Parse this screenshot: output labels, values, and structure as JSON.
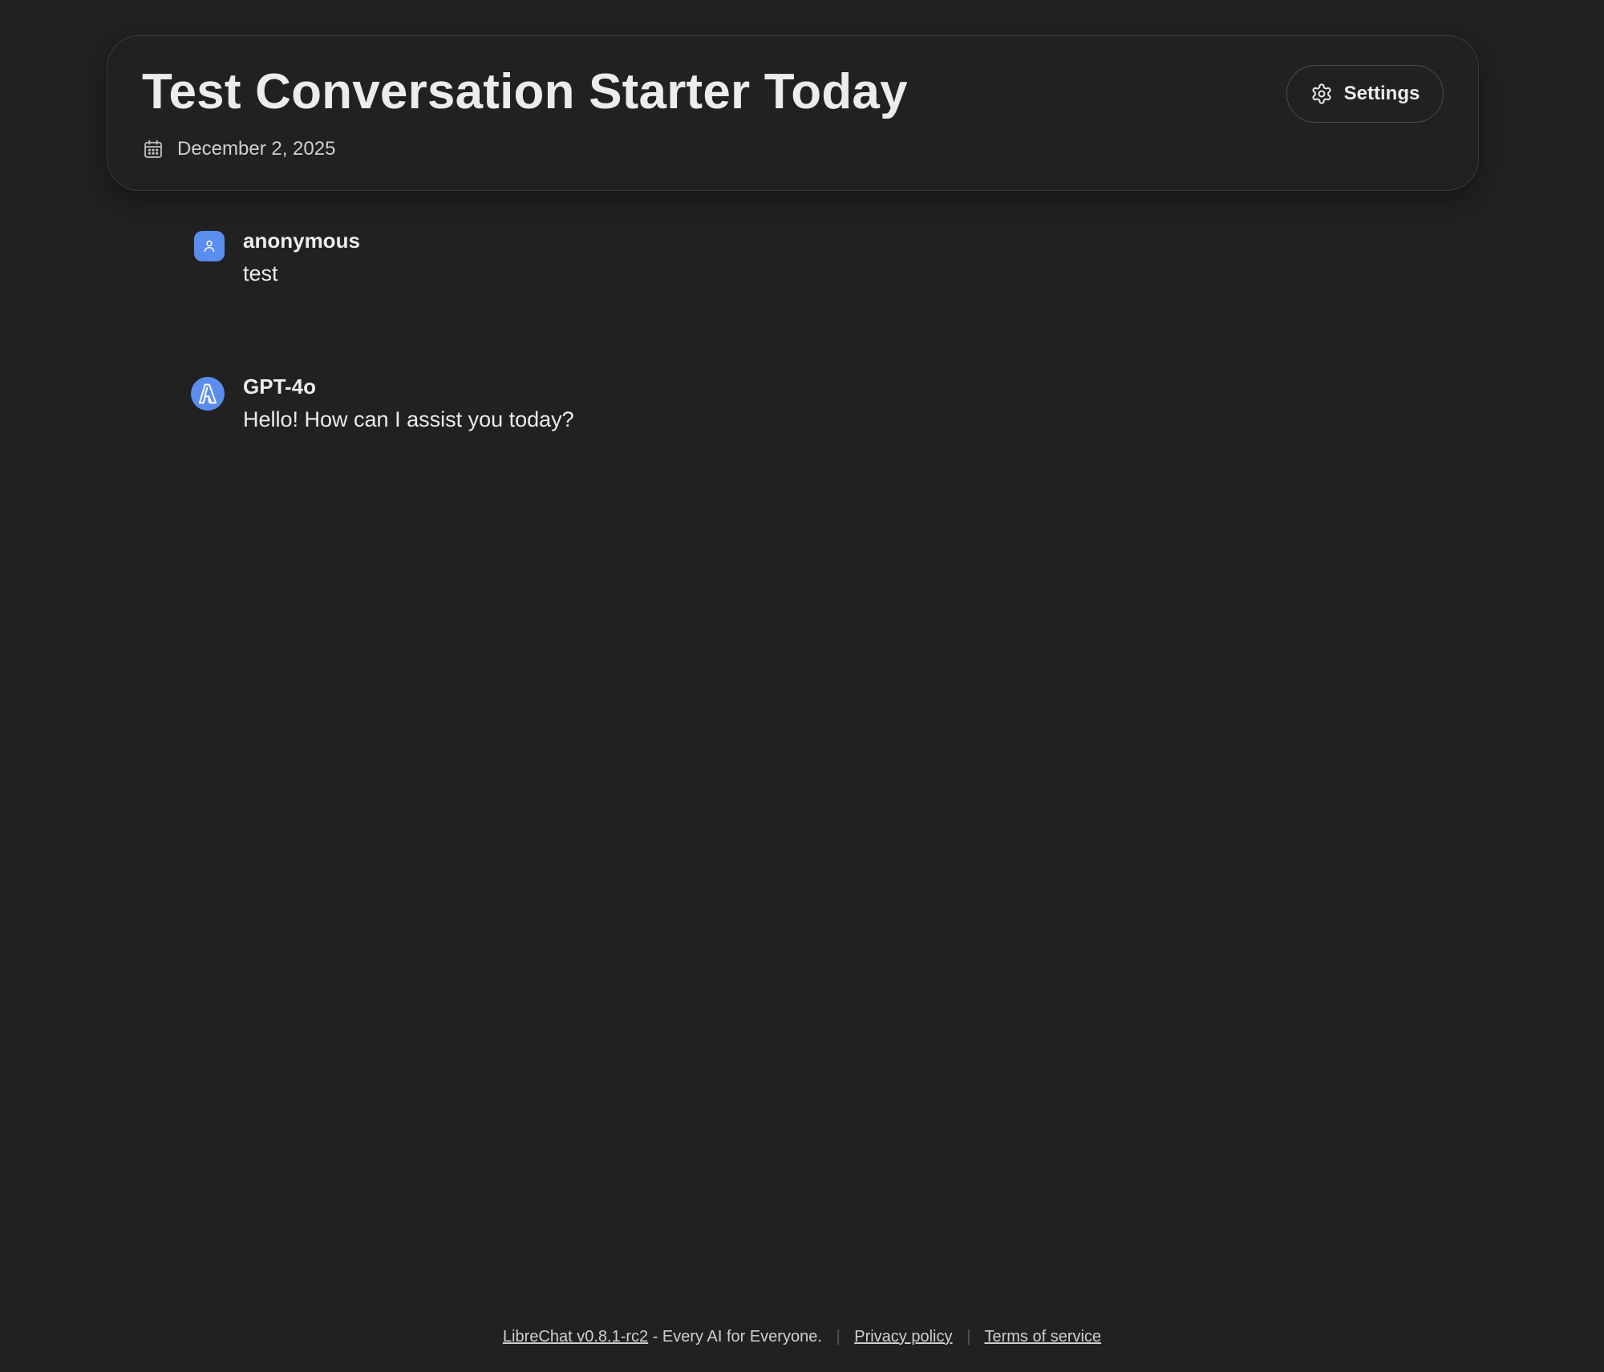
{
  "header": {
    "title": "Test Conversation Starter Today",
    "date": "December 2, 2025",
    "settings_label": "Settings"
  },
  "messages": [
    {
      "sender": "anonymous",
      "text": "test",
      "avatar_icon": "user-icon"
    },
    {
      "sender": "GPT-4o",
      "text": "Hello! How can I assist you today?",
      "avatar_icon": "azure-openai-icon"
    }
  ],
  "footer": {
    "version_link": "LibreChat v0.8.1-rc2",
    "tagline": "- Every AI for Everyone.",
    "privacy_link": "Privacy policy",
    "terms_link": "Terms of service"
  },
  "colors": {
    "background": "#212121",
    "accent": "#5b8dee",
    "text": "#ececec"
  }
}
